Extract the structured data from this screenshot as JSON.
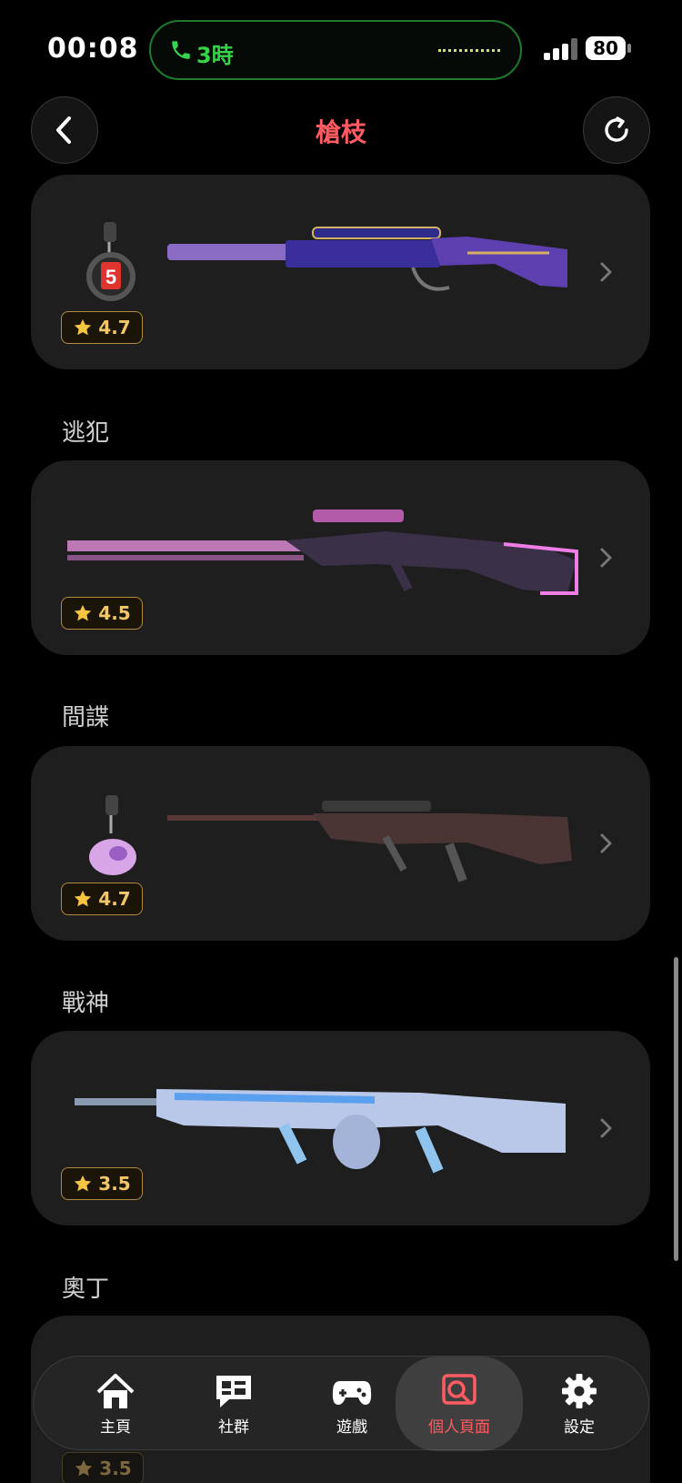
{
  "status_bar": {
    "time": "00:08",
    "call_label": "3時",
    "battery": "80"
  },
  "header": {
    "title": "槍枝"
  },
  "cards": [
    {
      "name": "",
      "rating": "4.7",
      "has_charm": true
    },
    {
      "name": "逃犯",
      "rating": "4.5",
      "has_charm": false
    },
    {
      "name": "間諜",
      "rating": "4.7",
      "has_charm": true
    },
    {
      "name": "戰神",
      "rating": "3.5",
      "has_charm": false
    }
  ],
  "partial_card": {
    "name": "奧丁",
    "rating": "3.5"
  },
  "tabbar": {
    "items": [
      {
        "label": "主頁",
        "icon": "home-icon"
      },
      {
        "label": "社群",
        "icon": "chat-icon"
      },
      {
        "label": "遊戲",
        "icon": "gamepad-icon"
      },
      {
        "label": "個人頁面",
        "icon": "profile-search-icon",
        "active": true
      },
      {
        "label": "設定",
        "icon": "gear-icon"
      }
    ]
  },
  "colors": {
    "accent": "#ff5b62",
    "call_green": "#37d34a",
    "rating_gold": "#f2c66a",
    "card_bg": "#1e1e1e"
  }
}
